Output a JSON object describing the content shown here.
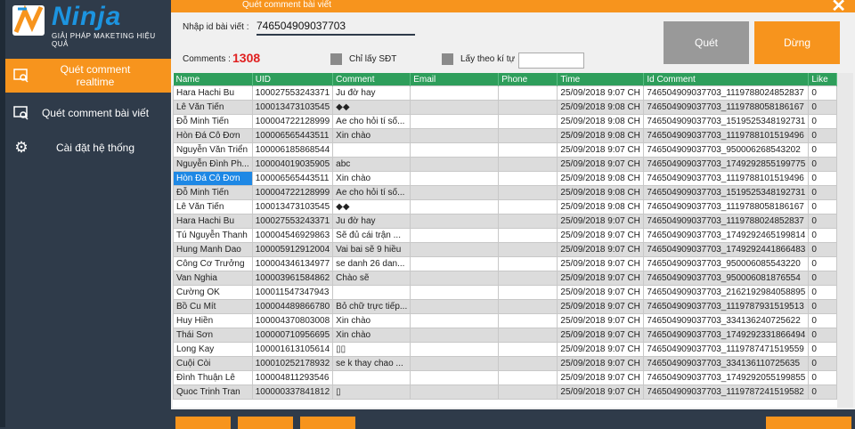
{
  "brand": {
    "name": "Ninja",
    "tagline": "GIẢI PHÁP MAKETING HIỆU QUẢ",
    "primary_color": "#f7941d",
    "sidebar_color": "#2f3b4a",
    "grid_header_color": "#2e9e5b"
  },
  "window": {
    "title": "Quét comment bài viết"
  },
  "sidebar": {
    "items": [
      {
        "label": "Quét comment realtime",
        "icon": "search-screen-icon",
        "active": true
      },
      {
        "label": "Quét comment bài viết",
        "icon": "search-screen-icon",
        "active": false
      },
      {
        "label": "Cài đặt hệ thống",
        "icon": "gear-icon",
        "active": false
      }
    ]
  },
  "form": {
    "post_id_label": "Nhập id bài viết :",
    "post_id_value": "746504909037703",
    "comments_label": "Comments :",
    "comments_count": "1308",
    "only_phone_label": "Chỉ lấy SĐT",
    "by_char_label": "Lấy theo kí tự",
    "by_char_value": ""
  },
  "buttons": {
    "scan": "Quét",
    "stop": "Dừng"
  },
  "table": {
    "columns": [
      "Name",
      "UID",
      "Comment",
      "Email",
      "Phone",
      "Time",
      "Id Comment",
      "Like"
    ],
    "rows": [
      [
        "Hara Hachi Bu",
        "100027553243371",
        "Ju đờ hay",
        "",
        "",
        "25/09/2018 9:07 CH",
        "746504909037703_1119788024852837",
        "0"
      ],
      [
        "Lê Văn Tiến",
        "100013473103545",
        "◆◆",
        "",
        "",
        "25/09/2018 9:08 CH",
        "746504909037703_1119788058186167",
        "0"
      ],
      [
        "Đỗ Minh Tiến",
        "100004722128999",
        "Ae cho hỏi tí số...",
        "",
        "",
        "25/09/2018 9:08 CH",
        "746504909037703_1519525348192731",
        "0"
      ],
      [
        "Hòn Đá Cô Đơn",
        "100006565443511",
        "Xin chào",
        "",
        "",
        "25/09/2018 9:08 CH",
        "746504909037703_1119788101519496",
        "0"
      ],
      [
        "Nguyễn Văn Triển",
        "100006185868544",
        "",
        "",
        "",
        "25/09/2018 9:07 CH",
        "746504909037703_950006268543202",
        "0"
      ],
      [
        "Nguyễn Đình Ph...",
        "100004019035905",
        "abc",
        "",
        "",
        "25/09/2018 9:07 CH",
        "746504909037703_1749292855199775",
        "0"
      ],
      [
        "Hòn Đá Cô Đơn",
        "100006565443511",
        "Xin chào",
        "",
        "",
        "25/09/2018 9:08 CH",
        "746504909037703_1119788101519496",
        "0"
      ],
      [
        "Đỗ Minh Tiến",
        "100004722128999",
        "Ae cho hỏi tí số...",
        "",
        "",
        "25/09/2018 9:08 CH",
        "746504909037703_1519525348192731",
        "0"
      ],
      [
        "Lê Văn Tiến",
        "100013473103545",
        "◆◆",
        "",
        "",
        "25/09/2018 9:08 CH",
        "746504909037703_1119788058186167",
        "0"
      ],
      [
        "Hara Hachi Bu",
        "100027553243371",
        "Ju đờ hay",
        "",
        "",
        "25/09/2018 9:07 CH",
        "746504909037703_1119788024852837",
        "0"
      ],
      [
        "Tú Nguyễn Thanh",
        "100004546929863",
        "Sẽ đủ cái trận ...",
        "",
        "",
        "25/09/2018 9:07 CH",
        "746504909037703_1749292465199814",
        "0"
      ],
      [
        "Hung Manh Dao",
        "100005912912004",
        "Vai bai sẽ 9 hiều",
        "",
        "",
        "25/09/2018 9:07 CH",
        "746504909037703_1749292441866483",
        "0"
      ],
      [
        "Công Cơ Trưởng",
        "100004346134977",
        "se danh 26 dan...",
        "",
        "",
        "25/09/2018 9:07 CH",
        "746504909037703_950006085543220",
        "0"
      ],
      [
        "Van Nghia",
        "100003961584862",
        "Chào sẽ",
        "",
        "",
        "25/09/2018 9:07 CH",
        "746504909037703_950006081876554",
        "0"
      ],
      [
        "Cường OK",
        "100011547347943",
        "",
        "",
        "",
        "25/09/2018 9:07 CH",
        "746504909037703_2162192984058895",
        "0"
      ],
      [
        "Bồ Cu Mít",
        "100004489866780",
        "Bỏ chữ trực tiếp...",
        "",
        "",
        "25/09/2018 9:07 CH",
        "746504909037703_1119787931519513",
        "0"
      ],
      [
        "Huy Hiền",
        "100004370803008",
        "Xin chào",
        "",
        "",
        "25/09/2018 9:07 CH",
        "746504909037703_334136240725622",
        "0"
      ],
      [
        "Thái Sơn",
        "100000710956695",
        "Xin chào",
        "",
        "",
        "25/09/2018 9:07 CH",
        "746504909037703_1749292331866494",
        "0"
      ],
      [
        "Long Kay",
        "100001613105614",
        "▯▯",
        "",
        "",
        "25/09/2018 9:07 CH",
        "746504909037703_1119787471519559",
        "0"
      ],
      [
        "Cuội Còi",
        "100010252178932",
        "se k thay chao ...",
        "",
        "",
        "25/09/2018 9:07 CH",
        "746504909037703_334136110725635",
        "0"
      ],
      [
        "Đình Thuận Lê",
        "100004811293546",
        "",
        "",
        "",
        "25/09/2018 9:07 CH",
        "746504909037703_1749292055199855",
        "0"
      ],
      [
        "Quoc Trinh Tran",
        "100000337841812",
        "▯",
        "",
        "",
        "25/09/2018 9:07 CH",
        "746504909037703_1119787241519582",
        "0"
      ]
    ]
  }
}
